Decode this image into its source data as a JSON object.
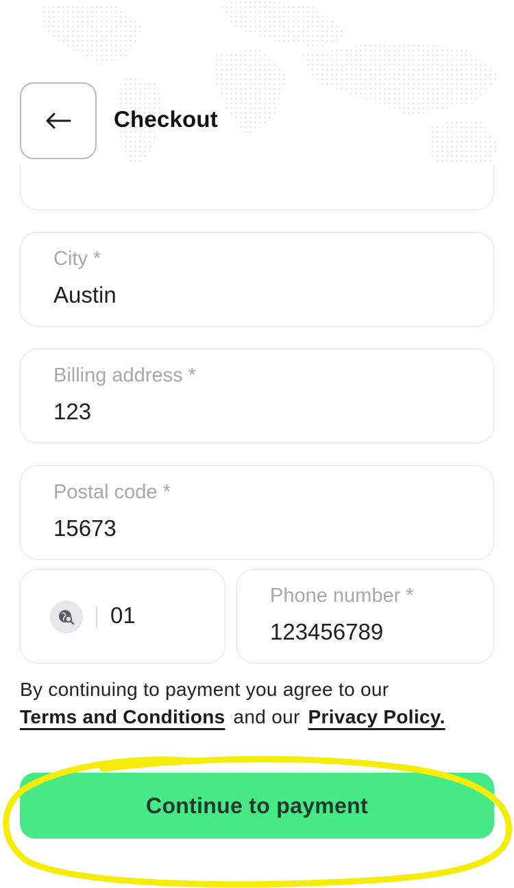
{
  "header": {
    "title": "Checkout",
    "back_icon": "arrow-left-icon"
  },
  "form": {
    "city": {
      "label": "City *",
      "value": "Austin"
    },
    "billing_address": {
      "label": "Billing address *",
      "value": "123"
    },
    "postal_code": {
      "label": "Postal code *",
      "value": "15673"
    },
    "country_code": {
      "icon": "globe-search-icon",
      "value": "01"
    },
    "phone_number": {
      "label": "Phone number *",
      "value": "123456789"
    }
  },
  "legal": {
    "prefix": "By continuing to payment you agree to our",
    "terms_link": "Terms and Conditions",
    "middle": "and our",
    "privacy_link": "Privacy Policy."
  },
  "actions": {
    "continue_label": "Continue to payment"
  },
  "colors": {
    "accent": "#45ea86",
    "highlight_annotation": "#f5ec0a"
  }
}
